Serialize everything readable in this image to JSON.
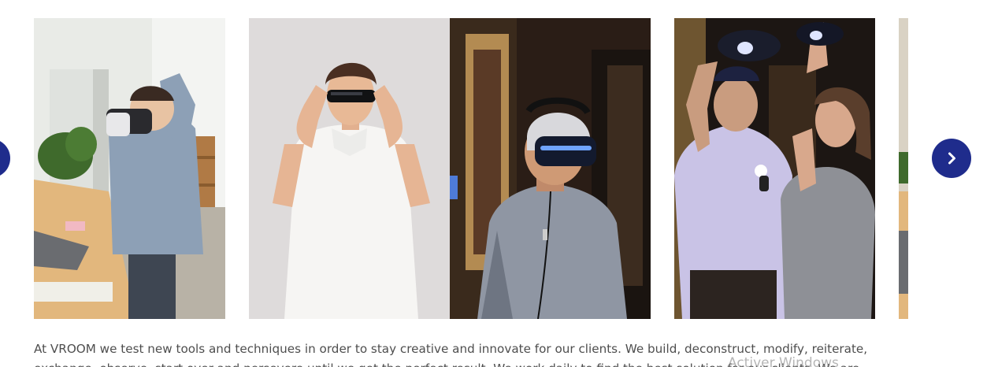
{
  "carousel": {
    "prev_icon": "chevron-left-icon",
    "next_icon": "chevron-right-icon",
    "accent_color": "#1f2c8c",
    "slides": [
      {
        "id": "slide-1",
        "icon": "vr-child-photo"
      },
      {
        "id": "slide-2",
        "icon": "futuristic-glasses-photo"
      },
      {
        "id": "slide-3",
        "icon": "vr-headset-man-photo"
      },
      {
        "id": "slide-4",
        "icon": "vr-couple-photo"
      },
      {
        "id": "slide-5",
        "icon": "partial-photo"
      }
    ]
  },
  "caption": {
    "line1": "At VROOM we test new tools and techniques in order to stay creative and innovate for our clients. We build, deconstruct, modify, reiterate,",
    "line2": "exchange, observe, start over and persevere until we get the perfect result. We work daily to find the best solution for our clients. We are"
  },
  "watermark": {
    "text": "Activer Windows"
  }
}
